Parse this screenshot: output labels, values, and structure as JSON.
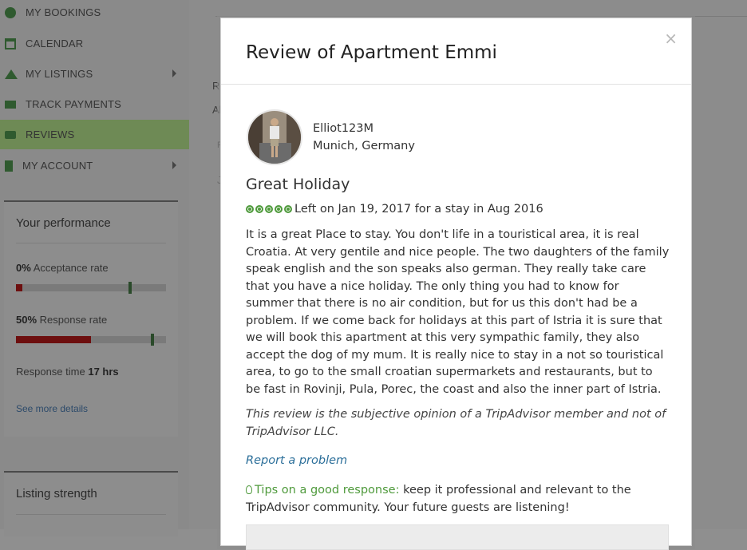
{
  "sidebar": {
    "items": [
      {
        "label": "MY BOOKINGS",
        "icon": "clock-icon"
      },
      {
        "label": "CALENDAR",
        "icon": "calendar-icon"
      },
      {
        "label": "MY LISTINGS",
        "icon": "home-icon"
      },
      {
        "label": "TRACK PAYMENTS",
        "icon": "payment-card-icon"
      },
      {
        "label": "REVIEWS",
        "icon": "chat-bubble-icon",
        "active": true
      },
      {
        "label": "MY ACCOUNT",
        "icon": "account-icon"
      }
    ]
  },
  "performance": {
    "title": "Your performance",
    "acceptance_value": "0%",
    "acceptance_label": "Acceptance rate",
    "acceptance_fill": 0.04,
    "response_value": "50%",
    "response_label": "Response rate",
    "response_fill": 0.5,
    "response_time_label": "Response time",
    "response_time_value": "17 hrs",
    "see_more": "See more details"
  },
  "listing_strength": {
    "title": "Listing strength"
  },
  "background_fragments": {
    "a": "Re",
    "b": "Al",
    "c": "F",
    "d": "J"
  },
  "modal": {
    "title": "Review of Apartment Emmi",
    "close": "×",
    "reviewer": {
      "name": "Elliot123M",
      "location": "Munich, Germany"
    },
    "review_title": "Great Holiday",
    "rating": 5,
    "rating_color": "#4f9a3c",
    "left_on": "Left on Jan 19, 2017 for a stay in Aug 2016",
    "body": "It is a great Place to stay. You don't life in a touristical area, it is real Croatia. At very gentile and nice people. The two daughters of the family speak english and the son speaks also german. They really take care that you have a nice holiday. The only thing you had to know for summer that there is no air condition, but for us this don't had be a problem. If we come back for holidays at this part of Istria it is sure that we will book this apartment at this very sympathic family, they also accept the dog of my mum. It is really nice to stay in a not so touristical area, to go to the small croatian supermarkets and restaurants, but to be fast in Rovinji, Pula, Porec, the coast and also the inner part of Istria.",
    "disclaimer": "This review is the subjective opinion of a TripAdvisor member and not of TripAdvisor LLC.",
    "report_link": "Report a problem",
    "tips_head": "Tips on a good response:",
    "tips_text": " keep it professional and relevant to the TripAdvisor community. Your future guests are listening!"
  }
}
